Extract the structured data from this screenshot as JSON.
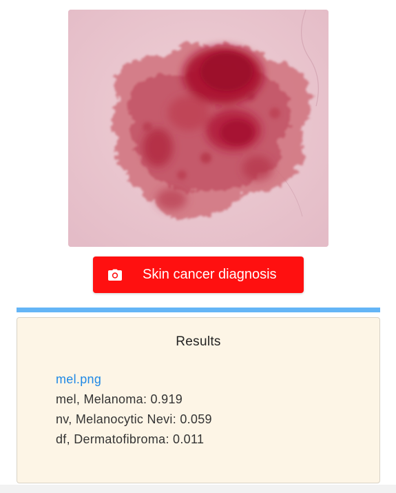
{
  "image": {
    "icon": "skin-lesion-image"
  },
  "diagnose_button": {
    "label": "Skin cancer diagnosis",
    "icon": "camera-icon",
    "color": "#ff1010"
  },
  "progress": {
    "value": 1.0,
    "color": "#64b5f6"
  },
  "results": {
    "title": "Results",
    "file_name": "mel.png",
    "predictions": [
      "mel, Melanoma: 0.919",
      "nv, Melanocytic Nevi: 0.059",
      "df, Dermatofibroma: 0.011"
    ],
    "link_color": "#1e88e5",
    "card_color": "#fdf5e6"
  }
}
